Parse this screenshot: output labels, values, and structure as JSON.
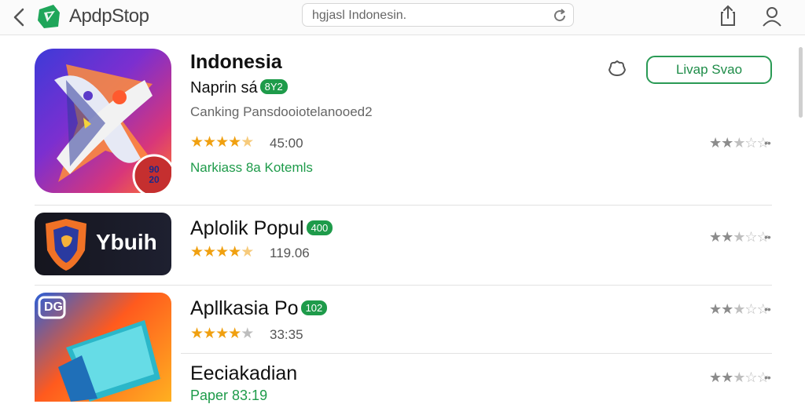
{
  "header": {
    "brand": "ApdpStop",
    "search_text": "hgjasl Indonesin.",
    "icons": [
      "back-chevron-icon",
      "appstop-logo-icon",
      "refresh-icon",
      "share-icon",
      "account-icon"
    ]
  },
  "featured": {
    "title": "Indonesia",
    "subtitle": "Naprin sá",
    "badge": "8Y2",
    "description": "Canking Pansdooiotelanooed2",
    "rating": 4.5,
    "rating_text": "45:00",
    "tagline": "Narkiass 8a Kotemls",
    "action_label": "Livap Svao",
    "right_rating": 2.5,
    "dots": "••"
  },
  "apps": [
    {
      "title": "Aplolik Popul",
      "badge": "400",
      "icon_text": "Ybuih",
      "rating": 4.5,
      "rating_text": "119.06",
      "right_rating": 2.5,
      "dots": "••"
    },
    {
      "title": "Apllkasia Po",
      "badge": "102",
      "icon_text": "DG",
      "rating": 4,
      "rating_text": "33:35",
      "right_rating": 2.5,
      "dots": "••"
    },
    {
      "title": "Eeciakadian",
      "tagline": "Paper 83:19",
      "right_rating": 2.5,
      "dots": "••"
    }
  ],
  "featured_icon_text": "90 20",
  "colors": {
    "accent_green": "#1e9b4a",
    "star_gold": "#f0a010"
  }
}
